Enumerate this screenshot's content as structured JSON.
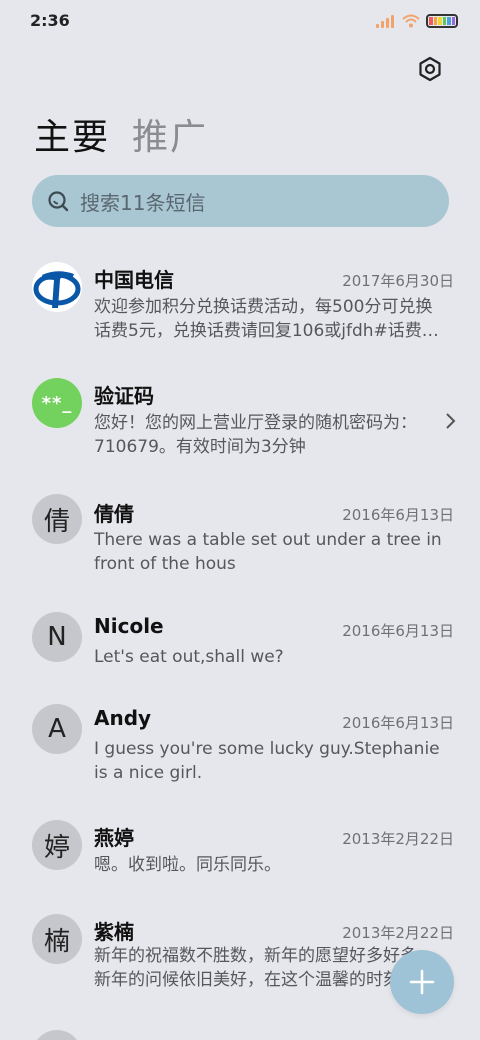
{
  "status": {
    "time": "2:36"
  },
  "tabs": [
    {
      "label": "主要",
      "active": true
    },
    {
      "label": "推广",
      "active": false
    }
  ],
  "search": {
    "placeholder": "搜索11条短信"
  },
  "icons": {
    "settings": "hexagon-settings-icon",
    "search": "search-icon",
    "fab": "plus-icon",
    "chevron": "chevron-right-icon"
  },
  "colors": {
    "background": "#e6e7ec",
    "search_bg": "#a9c7d2",
    "fab_bg": "#9fc3d6",
    "green_avatar": "#73d15e",
    "telecom_blue": "#0a57a8"
  },
  "messages": [
    {
      "avatar": "",
      "avatar_type": "telecom",
      "name": "中国电信",
      "date": "2017年6月30日",
      "preview": "欢迎参加积分兑换话费活动，每500分可兑换话费5元，兑换话费请回复106或jfdh#话费…"
    },
    {
      "avatar": "**_",
      "avatar_type": "green",
      "name": "验证码",
      "date": "",
      "preview": "您好！您的网上营业厅登录的随机密码为：710679。有效时间为3分钟"
    },
    {
      "avatar": "倩",
      "avatar_type": "letter",
      "name": "倩倩",
      "date": "2016年6月13日",
      "preview": "There was a table set out under a tree in front of the hous"
    },
    {
      "avatar": "N",
      "avatar_type": "letter",
      "name": "Nicole",
      "date": "2016年6月13日",
      "preview": "Let's eat out,shall we?"
    },
    {
      "avatar": "A",
      "avatar_type": "letter",
      "name": "Andy",
      "date": "2016年6月13日",
      "preview": "I guess you're some lucky guy.Stephanie is a nice girl."
    },
    {
      "avatar": "婷",
      "avatar_type": "letter",
      "name": "燕婷",
      "date": "2013年2月22日",
      "preview": "嗯。收到啦。同乐同乐。"
    },
    {
      "avatar": "楠",
      "avatar_type": "letter",
      "name": "紫楠",
      "date": "2013年2月22日",
      "preview": "新年的祝福数不胜数，新年的愿望好多好多，新年的问候依旧美好，在这个温馨的时刻…"
    }
  ]
}
